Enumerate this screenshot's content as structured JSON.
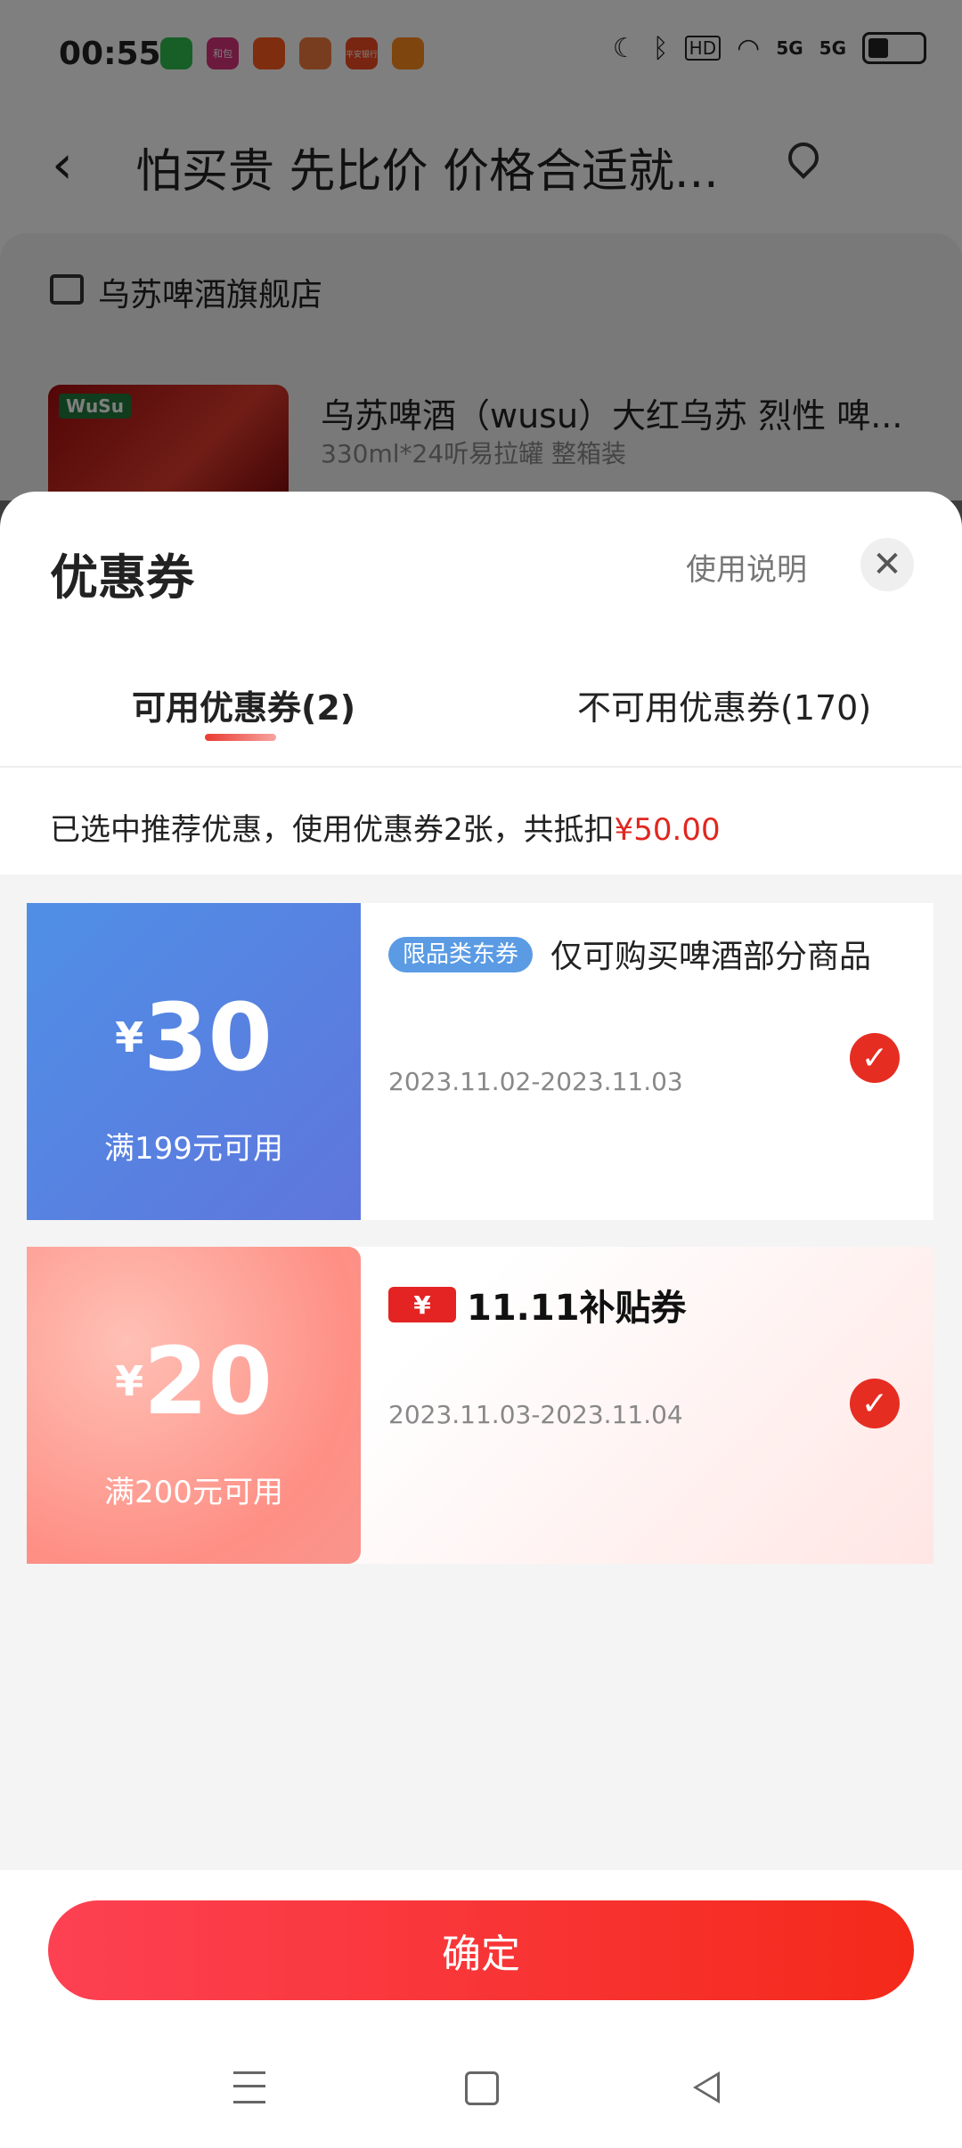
{
  "status_bar": {
    "time": "00:55",
    "app_icons": [
      {
        "name": "messages-app-icon",
        "label": "",
        "color": "#2fbf4f"
      },
      {
        "name": "hebao-app-icon",
        "label": "和包",
        "color": "#d9327c"
      },
      {
        "name": "kuaishou-app-icon",
        "label": "",
        "color": "#ff5a1e"
      },
      {
        "name": "app-icon-4",
        "label": "",
        "color": "#f07a3c"
      },
      {
        "name": "pingan-bank-app-icon",
        "label": "平安银行",
        "color": "#f04a22"
      },
      {
        "name": "app-icon-6",
        "label": "",
        "color": "#ff8a1f"
      }
    ],
    "hd_label": "HD",
    "network_1": "5G",
    "network_2": "5G"
  },
  "background_page": {
    "title": "怕买贵 先比价 价格合适就...",
    "store_name": "乌苏啤酒旗舰店",
    "product_title": "乌苏啤酒（wusu）大红乌苏 烈性 啤...",
    "product_spec": "330ml*24听易拉罐 整箱装",
    "product_logo_text": "WuSu"
  },
  "sheet": {
    "title": "优惠券",
    "usage_link": "使用说明",
    "close_icon": "✕",
    "tabs": [
      {
        "label": "可用优惠券(2)",
        "active": true
      },
      {
        "label": "不可用优惠券(170)",
        "active": false
      }
    ],
    "summary_prefix": "已选中推荐优惠，使用优惠券2张，共抵扣",
    "summary_amount": "¥50.00",
    "accent_color": "#e0271f"
  },
  "coupons": [
    {
      "currency": "¥",
      "amount": "30",
      "condition": "满199元可用",
      "badge": "限品类东券",
      "title": "仅可购买啤酒部分商品",
      "date_range": "2023.11.02-2023.11.03",
      "selected": true
    },
    {
      "currency": "¥",
      "amount": "20",
      "condition": "满200元可用",
      "badge_icon": "¥",
      "title": "11.11补贴券",
      "date_range": "2023.11.03-2023.11.04",
      "selected": true
    }
  ],
  "confirm_label": "确定"
}
